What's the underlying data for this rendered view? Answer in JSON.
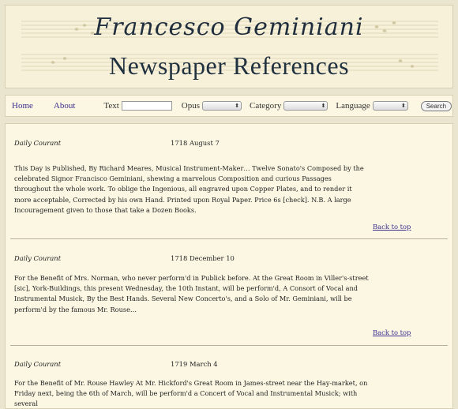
{
  "header": {
    "script_title": "Francesco Geminiani",
    "main_title": "Newspaper References"
  },
  "nav": {
    "home": "Home",
    "about": "About",
    "text_label": "Text",
    "text_value": "",
    "opus_label": "Opus",
    "opus_value": "",
    "category_label": "Category",
    "category_value": "",
    "language_label": "Language",
    "language_value": "",
    "search_button": "Search"
  },
  "entries": [
    {
      "paper": "Daily Courant",
      "date": "1718 August 7",
      "text": "This Day is Published, By Richard Meares, Musical Instrument-Maker… Twelve Sonato's Composed by the celebrated Signor Francisco Geminiani, shewing a marvelous Composition and curious Passages throughout the whole work. To oblige the Ingenious, all engraved upon Copper Plates, and to render it more acceptable, Corrected by his own Hand. Printed upon Royal Paper. Price 6s [check]. N.B. A large Incouragement given to those that take a Dozen Books.",
      "back": "Back to top"
    },
    {
      "paper": "Daily Courant",
      "date": "1718 December 10",
      "text": "For the Benefit of Mrs. Norman, who never perform'd in Publick before. At the Great Room in Viller's-street [sic], York-Buildings, this present Wednesday, the 10th Instant, will be perform'd, A Consort of Vocal and Instrumental Musick, By the Best Hands. Several New Concerto's, and a Solo of Mr. Geminiani, will be perform'd by the famous Mr. Rouse…",
      "back": "Back to top"
    },
    {
      "paper": "Daily Courant",
      "date": "1719 March 4",
      "text": "For the Benefit of Mr. Rouse Hawley At Mr. Hickford's Great Room in James-street near the Hay-market, on Friday next, being the 6th of March, will be perform'd a Concert of Vocal and Instrumental Musick; with several"
    }
  ]
}
